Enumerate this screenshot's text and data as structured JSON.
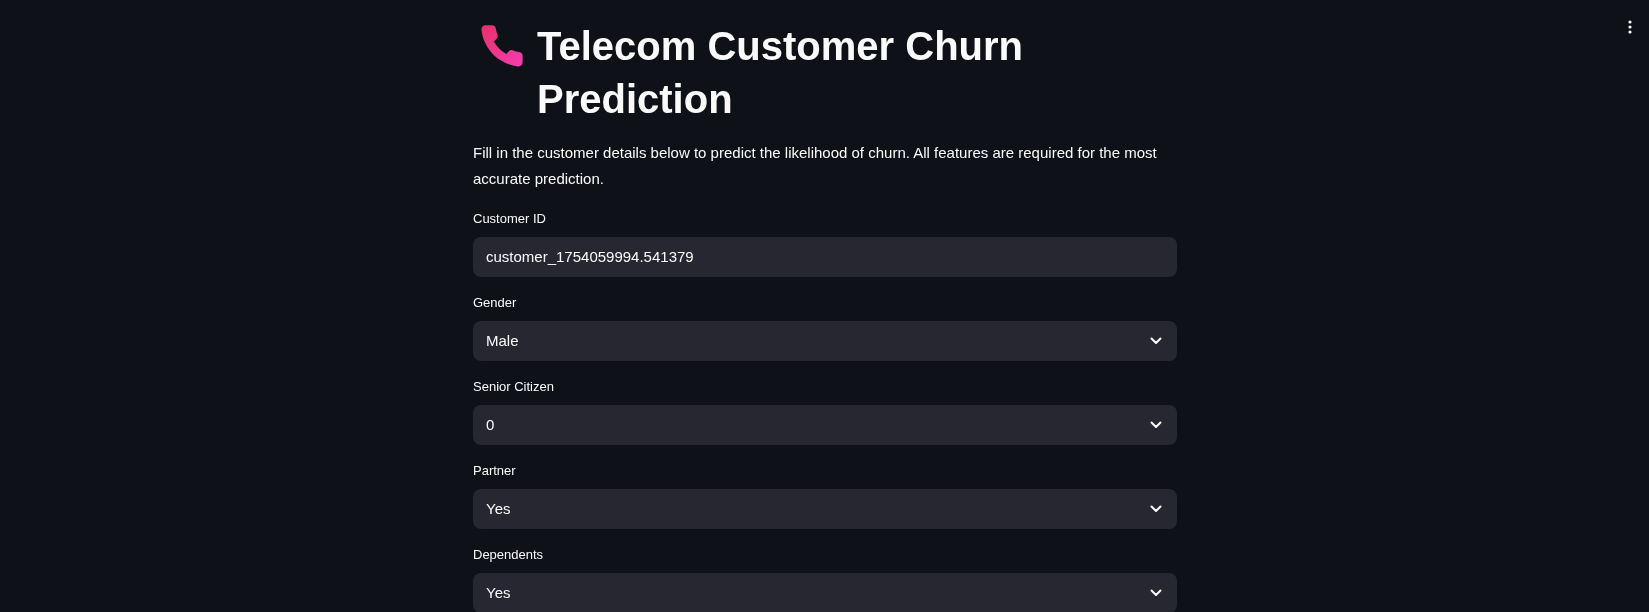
{
  "title": "Telecom Customer Churn Prediction",
  "description": "Fill in the customer details below to predict the likelihood of churn. All features are required for the most accurate prediction.",
  "fields": [
    {
      "kind": "text",
      "label": "Customer ID",
      "value": "customer_1754059994.541379"
    },
    {
      "kind": "select",
      "label": "Gender",
      "value": "Male"
    },
    {
      "kind": "select",
      "label": "Senior Citizen",
      "value": "0"
    },
    {
      "kind": "select",
      "label": "Partner",
      "value": "Yes"
    },
    {
      "kind": "select",
      "label": "Dependents",
      "value": "Yes"
    }
  ]
}
